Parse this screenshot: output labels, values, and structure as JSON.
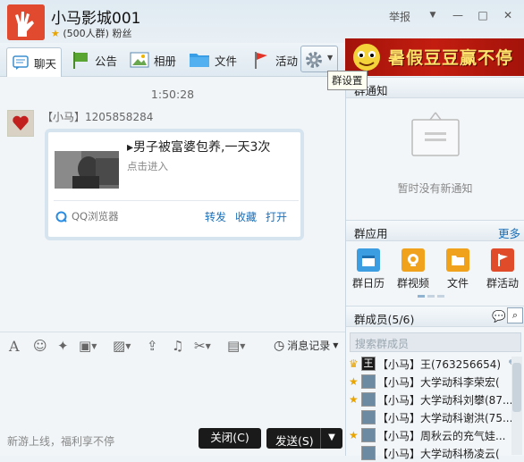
{
  "window": {
    "title": "小马影城001",
    "member_count": "(500人群)",
    "fans": "粉丝",
    "report": "举报",
    "min": "—",
    "max": "□",
    "close": "✕",
    "dropdown": "▼"
  },
  "tabs": [
    {
      "label": "聊天",
      "icon": "chat-icon"
    },
    {
      "label": "公告",
      "icon": "announcement-icon"
    },
    {
      "label": "相册",
      "icon": "album-icon"
    },
    {
      "label": "文件",
      "icon": "folder-icon"
    },
    {
      "label": "活动",
      "icon": "flag-icon"
    }
  ],
  "settings": {
    "tooltip": "群设置",
    "icon": "gear-icon"
  },
  "banner": {
    "text": "暑假豆豆赢不停"
  },
  "chat": {
    "timestamp": "1:50:28",
    "sender": "【小马】1205858284",
    "card": {
      "title": "▸男子被富婆包养,一天3次",
      "subtitle": "点击进入",
      "source": "QQ浏览器",
      "actions": [
        "转发",
        "收藏",
        "打开"
      ]
    }
  },
  "editor_tools": {
    "history": "消息记录"
  },
  "bottom": {
    "tip": "新游上线，福利享不停",
    "close": "关闭(C)",
    "send": "发送(S)"
  },
  "right": {
    "notice_header": "群通知",
    "notice_empty": "暂时没有新通知",
    "apps_header": "群应用",
    "more": "更多",
    "apps": [
      {
        "label": "群日历",
        "icon": "calendar-icon",
        "color": "#3c9ee0"
      },
      {
        "label": "群视频",
        "icon": "video-icon",
        "color": "#f0a21c"
      },
      {
        "label": "文件",
        "icon": "folder-icon",
        "color": "#f0a21c"
      },
      {
        "label": "群活动",
        "icon": "flag-icon",
        "color": "#e04b2a"
      }
    ],
    "members_header": "群成员(5/6)",
    "search_placeholder": "搜索群成员",
    "members": [
      "【小马】王(763256654)",
      "【小马】大学动科李荣宏(",
      "【小马】大学动科刘攀(87...",
      "【小马】大学动科谢洪(75...",
      "【小马】周秋云的充气娃...",
      "【小马】大学动科杨凌云("
    ]
  },
  "colors": {
    "accent": "#1a6fb8",
    "banner": "#b3150c",
    "banner_text": "#ffe36a"
  }
}
